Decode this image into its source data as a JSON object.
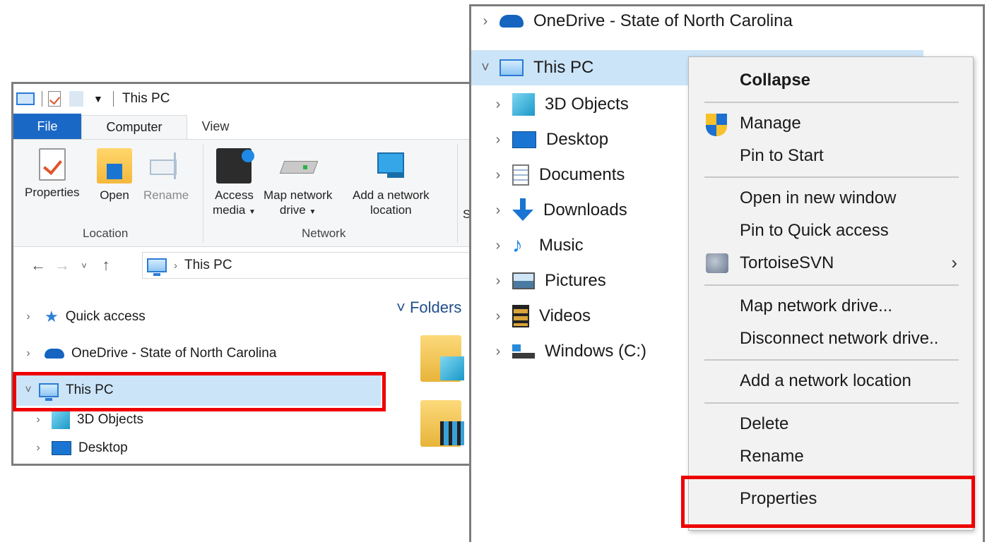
{
  "left_window": {
    "title": "This PC",
    "tabs": [
      "File",
      "Computer",
      "View"
    ],
    "ribbon": {
      "location_group": {
        "label": "Location",
        "buttons": [
          "Properties",
          "Open",
          "Rename"
        ]
      },
      "network_group": {
        "label": "Network",
        "access_media_line1": "Access",
        "access_media_line2": "media",
        "map_drive_line1": "Map network",
        "map_drive_line2": "drive",
        "add_location_line1": "Add a network",
        "add_location_line2": "location",
        "cut_label": "S"
      }
    },
    "address": {
      "path": "This PC"
    },
    "nav_tree": [
      {
        "label": "Quick access",
        "icon": "star-icon"
      },
      {
        "label": "OneDrive - State of North Carolina",
        "icon": "cloud-icon"
      },
      {
        "label": "This PC",
        "icon": "computer-icon",
        "selected": true
      },
      {
        "label": "3D Objects",
        "icon": "cube-icon"
      },
      {
        "label": "Desktop",
        "icon": "desktop-icon"
      }
    ],
    "content": {
      "folders_header": "Folders"
    }
  },
  "right_window": {
    "tree": [
      {
        "label": "OneDrive - State of North Carolina",
        "icon": "cloud-icon"
      },
      {
        "label": "This PC",
        "icon": "computer-icon",
        "selected": true
      },
      {
        "label": "3D Objects",
        "icon": "cube-icon"
      },
      {
        "label": "Desktop",
        "icon": "desktop-icon"
      },
      {
        "label": "Documents",
        "icon": "document-icon"
      },
      {
        "label": "Downloads",
        "icon": "download-icon"
      },
      {
        "label": "Music",
        "icon": "music-icon"
      },
      {
        "label": "Pictures",
        "icon": "pictures-icon"
      },
      {
        "label": "Videos",
        "icon": "video-icon"
      },
      {
        "label": "Windows (C:)",
        "icon": "drive-icon"
      }
    ],
    "context_menu": {
      "collapse": "Collapse",
      "manage": "Manage",
      "pin_to_start": "Pin to Start",
      "open_new_window": "Open in new window",
      "pin_quick_access": "Pin to Quick access",
      "tortoise_svn": "TortoiseSVN",
      "map_network_drive": "Map network drive...",
      "disconnect_network_drive": "Disconnect network drive..",
      "add_network_location": "Add a network location",
      "delete": "Delete",
      "rename": "Rename",
      "properties": "Properties"
    }
  },
  "colors": {
    "highlight_box": "#ee0000",
    "selection": "#cce4f7",
    "file_tab": "#1a68c6",
    "menu_bg": "#f2f2f2"
  }
}
